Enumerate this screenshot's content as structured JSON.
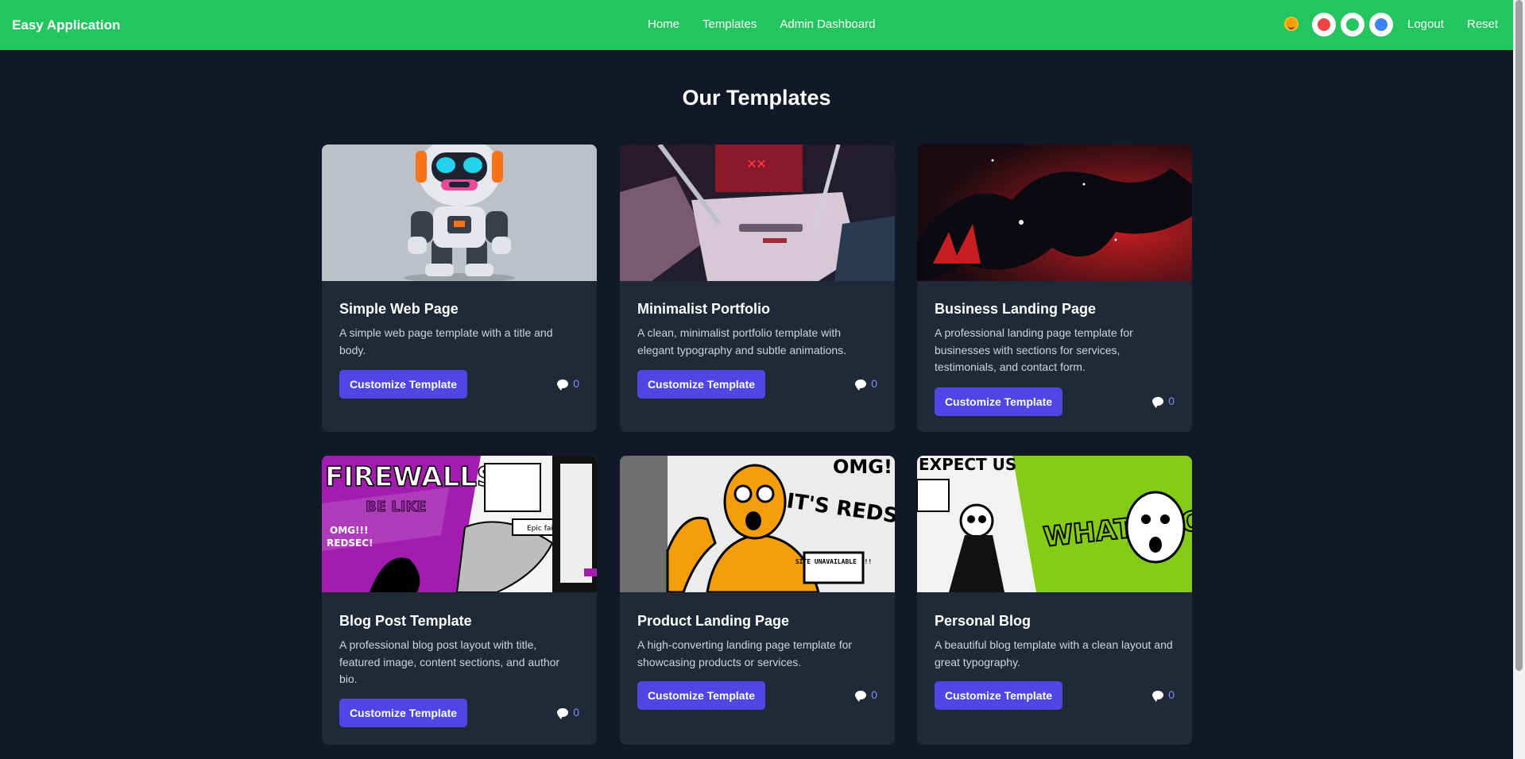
{
  "nav": {
    "brand": "Easy Application",
    "links": [
      "Home",
      "Templates",
      "Admin Dashboard"
    ],
    "emoji_icon": "smiley-icon",
    "theme_colors": [
      "#ef4444",
      "#22c55e",
      "#3b82f6"
    ],
    "logout": "Logout",
    "reset": "Reset"
  },
  "page": {
    "title": "Our Templates"
  },
  "cards": [
    {
      "title": "Simple Web Page",
      "description": "A simple web page template with a title and body.",
      "button": "Customize Template",
      "comments": "0",
      "image": "robot-toy"
    },
    {
      "title": "Minimalist Portfolio",
      "description": "A clean, minimalist portfolio template with elegant typography and subtle animations.",
      "button": "Customize Template",
      "comments": "0",
      "image": "robot-close-up"
    },
    {
      "title": "Business Landing Page",
      "description": "A professional landing page template for businesses with sections for services, testimonials, and contact form.",
      "button": "Customize Template",
      "comments": "0",
      "image": "dark-dragon-red"
    },
    {
      "title": "Blog Post Template",
      "description": "A professional blog post layout with title, featured image, content sections, and author bio.",
      "button": "Customize Template",
      "comments": "0",
      "image": "comic-firewalls-purple"
    },
    {
      "title": "Product Landing Page",
      "description": "A high-converting landing page template for showcasing products or services.",
      "button": "Customize Template",
      "comments": "0",
      "image": "comic-orange-man"
    },
    {
      "title": "Personal Blog",
      "description": "A beautiful blog template with a clean layout and great typography.",
      "button": "Customize Template",
      "comments": "0",
      "image": "comic-lime-skeleton"
    }
  ],
  "art_text": {
    "firewalls": "FIREWALLS",
    "be_like": "BE LIKE",
    "omg": "OMG!!!",
    "redsec": "REDSEC!",
    "epic_fail": "Epic fail.",
    "omg2": "OMG!!",
    "its_redsec": "IT'S REDSE",
    "site_unavailable": "SITE UNAVAILABLE !!!",
    "what_look": "WHAT LOOK",
    "expect_us": "EXPECT US"
  },
  "colors": {
    "navbar": "#22c55e",
    "background": "#111827",
    "card": "#1f2937",
    "button": "#4f46e5"
  }
}
